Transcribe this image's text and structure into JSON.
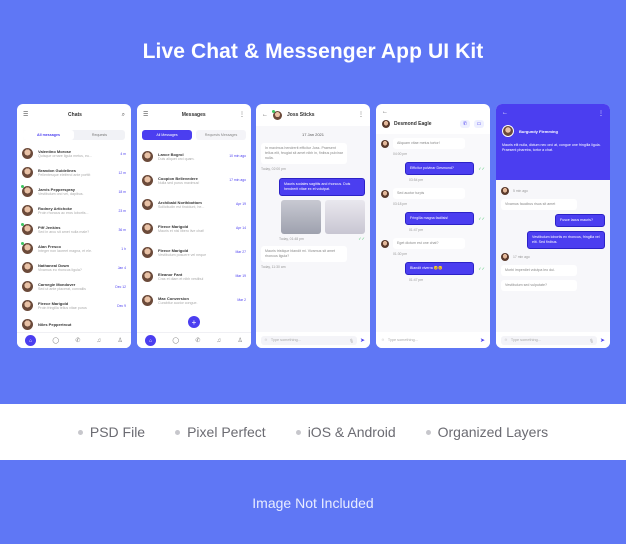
{
  "title": "Live Chat & Messenger App UI Kit",
  "features": [
    "PSD File",
    "Pixel Perfect",
    "iOS & Android",
    "Organized Layers"
  ],
  "footnote": "Image Not Included",
  "colors": {
    "background": "#5f77f5",
    "accent": "#4b3ef0",
    "online": "#3cc561"
  },
  "screen1": {
    "title": "Chats",
    "tabs": [
      "All messages",
      "Requests"
    ],
    "chats": [
      {
        "name": "Valentino Morose",
        "preview": "Quisque ornare ligula metus, eu...",
        "time": "4 m",
        "online": false
      },
      {
        "name": "Brandon Guidelines",
        "preview": "Pellentesque eleifend ante porttit",
        "time": "12 m",
        "online": false
      },
      {
        "name": "Jarvis Pepperspray",
        "preview": "Vestibulum orci vel, dapibus.",
        "time": "18 m",
        "online": true
      },
      {
        "name": "Rodney Artichoke",
        "preview": "Proin rhoncus ac eros lobortis...",
        "time": "23 m",
        "online": false
      },
      {
        "name": "Piff Jenkins",
        "preview": "Sed in arcu sit amet nulla male?",
        "time": "36 m",
        "online": true
      },
      {
        "name": "Alan Fresco",
        "preview": "Integer non laoreet magna, et ele.",
        "time": "1 h",
        "online": true
      },
      {
        "name": "Nathaneal Down",
        "preview": "Vivamus eu rhoncus ligula?",
        "time": "Jan 4",
        "online": false
      },
      {
        "name": "Carnegie Mondover",
        "preview": "Sed ut ante placerat, convallis",
        "time": "Dec 12",
        "online": false
      },
      {
        "name": "Fleece Marigold",
        "preview": "Proin fringilla tellus vitae purus",
        "time": "Dec 9",
        "online": false
      },
      {
        "name": "Niles Peppertrout",
        "preview": "",
        "time": "",
        "online": false
      }
    ]
  },
  "screen2": {
    "title": "Messages",
    "tabs": [
      "All Messages",
      "Requests Messages"
    ],
    "chats": [
      {
        "name": "Lance Bogrol",
        "preview": "Duis aliquet orci quam.",
        "time": "10 min ago"
      },
      {
        "name": "Coopion Bellevedere",
        "preview": "Nulla sed purus maximus!",
        "time": "17 min ago"
      },
      {
        "name": "Archibald Northbottom",
        "preview": "Sollicitudin est tincidunt, he...",
        "time": "Apr 19"
      },
      {
        "name": "Fleece Marigold",
        "preview": "Mauris et nisl libero live chat!",
        "time": "Apr 14"
      },
      {
        "name": "Fleece Marigold",
        "preview": "Vestibulum posuere vel neque",
        "time": "Mar 27"
      },
      {
        "name": "Eleanor Fant",
        "preview": "Cras et diam et nibh vestibul",
        "time": "Mar 19"
      },
      {
        "name": "Max Conversion",
        "preview": "Curabitur auctor congue.",
        "time": "Mar 2"
      }
    ]
  },
  "screen3": {
    "contact": "Joss Sticks",
    "date": "17 Jan 2021",
    "messages": [
      {
        "dir": "in",
        "text": "In maximus hendrerit efficitur Joss. Praesent tellus elit, feugiat sit amet nibh in, finibus pulvinar nulla.",
        "time": "Today, 02:00 pm"
      },
      {
        "dir": "out",
        "text": "Mauris sodales sagittis and rhoncus. Duis hendrerit vitae ex et volutpat."
      },
      {
        "dir": "out-images",
        "time": "Today, 01:48 pm"
      },
      {
        "dir": "in",
        "text": "Mauris tristique blandit mi. Vivamus sit amet rhoncus ligula?",
        "time": "Today, 11:30 am"
      }
    ],
    "input_placeholder": "Type something..."
  },
  "screen4": {
    "contact": "Desmond Eagle",
    "messages": [
      {
        "dir": "in",
        "text": "Aliquam vitae metus tortor!",
        "time": "04:00 pm"
      },
      {
        "dir": "out",
        "text": "Efficitur pulvinar Desmond?",
        "time": "03:54 pm"
      },
      {
        "dir": "in",
        "text": "Sed auctor turpis",
        "time": "03:18 pm"
      },
      {
        "dir": "out",
        "text": "Fringilla magna facilisis!",
        "time": "01:47 pm"
      },
      {
        "dir": "in",
        "text": "Eget dictum est one chat?",
        "time": "01:30 pm"
      },
      {
        "dir": "out",
        "text": "Blandit viverra 😊😊",
        "time": "01:47 pm"
      }
    ],
    "input_placeholder": "Type something..."
  },
  "screen5": {
    "contact": "Burgundy Flemming",
    "bio": "Mauris elit nulla, dictum nec orci at, congue one fringilla ligula. Praesent pharetra, tortor a chat.",
    "groups": [
      {
        "time": "5 min ago",
        "in": [
          "Vivamus faucibus risus sit amet"
        ],
        "out": [
          "Fusce lacus mauris?",
          "Vestibulum lobortis ex rhoncus, fringilla vel elit. Sed finibus."
        ]
      },
      {
        "time": "17 min ago",
        "in": [
          "Morbi imperdiet volutpa leo dui.",
          "Vestibulum sed vulputate?"
        ],
        "out": []
      }
    ],
    "input_placeholder": "Type something..."
  }
}
